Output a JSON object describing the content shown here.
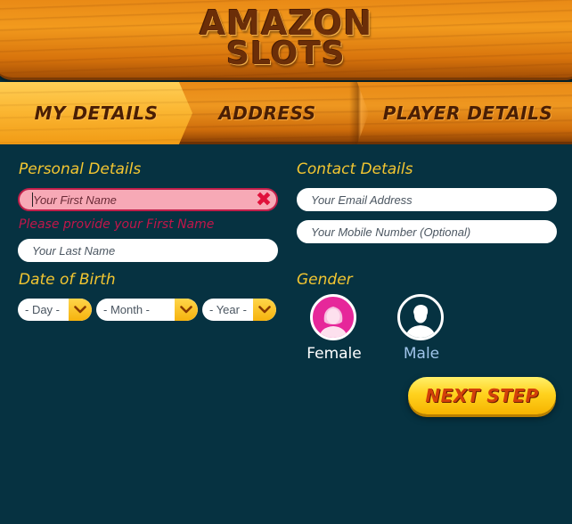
{
  "header": {
    "logo_line1": "AMAZON",
    "logo_line2": "SLOTS"
  },
  "tabs": [
    {
      "label": "MY DETAILS",
      "active": true
    },
    {
      "label": "ADDRESS",
      "active": false
    },
    {
      "label": "PLAYER DETAILS",
      "active": false
    }
  ],
  "personal": {
    "title": "Personal Details",
    "first_name_placeholder": "Your First Name",
    "first_name_error": "Please provide your First Name",
    "last_name_placeholder": "Your Last Name"
  },
  "contact": {
    "title": "Contact Details",
    "email_placeholder": "Your Email Address",
    "mobile_placeholder": "Your Mobile Number (Optional)"
  },
  "dob": {
    "title": "Date of Birth",
    "day": "- Day -",
    "month": "- Month -",
    "year": "- Year -"
  },
  "gender": {
    "title": "Gender",
    "female_label": "Female",
    "male_label": "Male"
  },
  "next_button": "NEXT STEP",
  "colors": {
    "background": "#063241",
    "accent_yellow": "#f3c631",
    "error_red": "#c2164a",
    "female_pink": "#e6279a",
    "male_label": "#9fc4ea"
  }
}
